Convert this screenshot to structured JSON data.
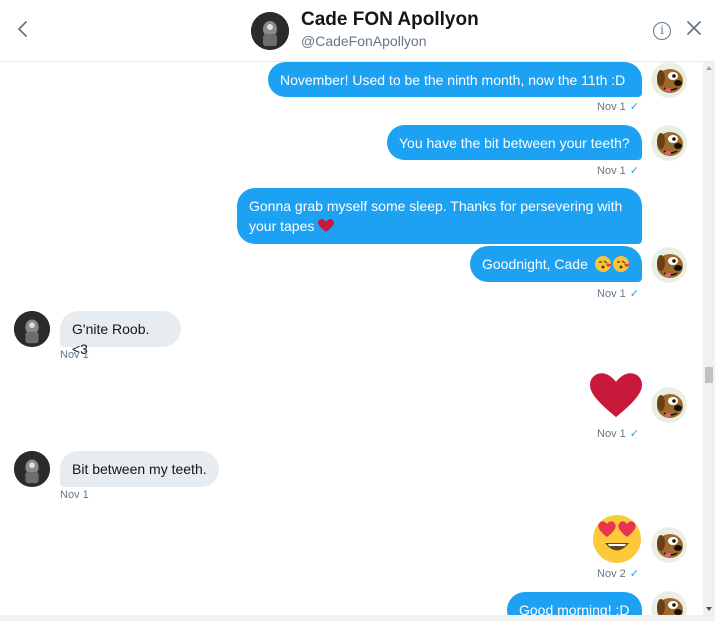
{
  "header": {
    "title": "Cade FON Apollyon",
    "handle": "@CadeFonApollyon"
  },
  "colors": {
    "accent": "#1da1f2",
    "incoming": "#e6ecf0",
    "muted": "#657786"
  },
  "messages": [
    {
      "dir": "out",
      "text": "November! Used to be the ninth month, now the 11th :D",
      "time": "Nov 1"
    },
    {
      "dir": "out",
      "text": "You have the bit between your teeth?",
      "time": "Nov 1"
    },
    {
      "dir": "out",
      "text": "Gonna grab myself some sleep. Thanks for persevering with your tapes",
      "emoji": "red-heart"
    },
    {
      "dir": "out",
      "text": "Goodnight, Cade",
      "emoji": "kissing-face-x2",
      "time": "Nov 1"
    },
    {
      "dir": "in",
      "text": "G'nite Roob. <3",
      "time": "Nov 1"
    },
    {
      "dir": "out",
      "emoji": "large-red-heart",
      "time": "Nov 1"
    },
    {
      "dir": "in",
      "text": "Bit between my teeth.",
      "time": "Nov 1"
    },
    {
      "dir": "out",
      "emoji": "heart-eyes-face",
      "time": "Nov 2"
    },
    {
      "dir": "out",
      "text": "Good morning! :D"
    }
  ],
  "check": "✓"
}
